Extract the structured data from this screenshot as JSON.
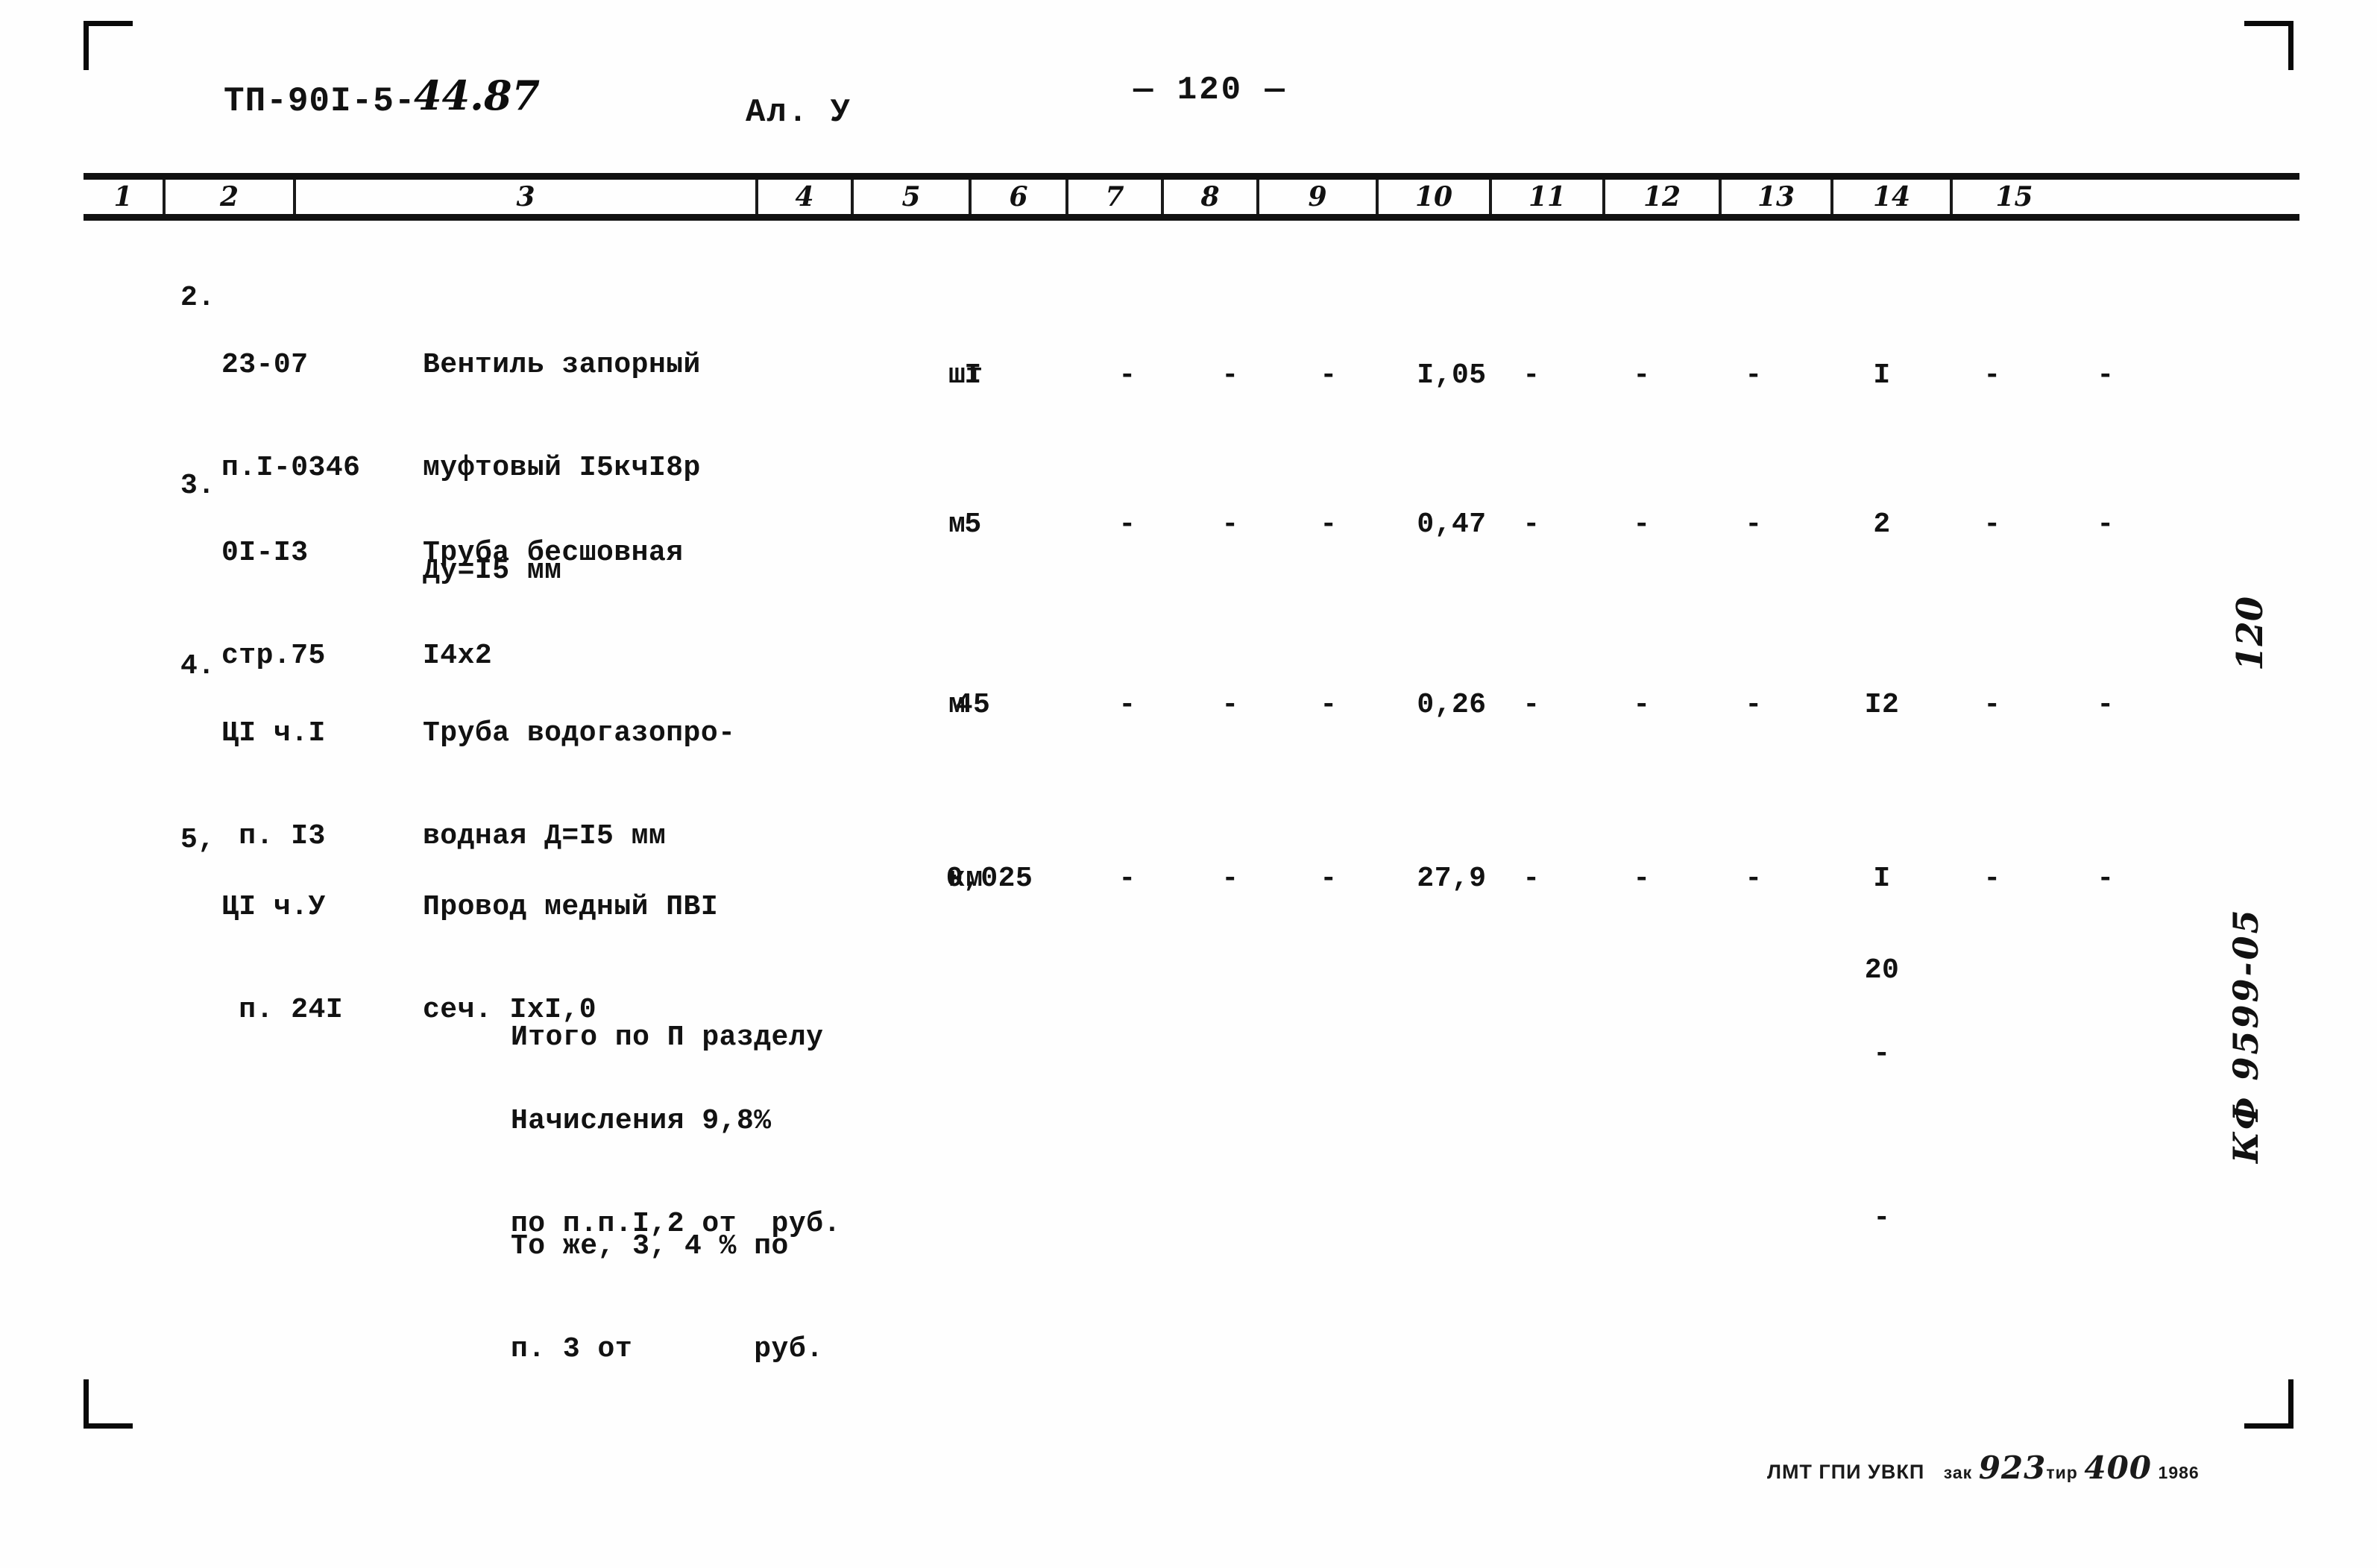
{
  "document": {
    "code_typed": "ТП-90I-5-",
    "code_handwritten": "44.87",
    "album": "Ал. У",
    "page_marker": "— 120 —"
  },
  "table": {
    "column_headers": [
      "1",
      "2",
      "3",
      "4",
      "5",
      "6",
      "7",
      "8",
      "9",
      "10",
      "11",
      "12",
      "13",
      "14",
      "15"
    ],
    "rows": [
      {
        "num": "2.",
        "code_lines": [
          "23-07",
          "п.I-0346",
          ""
        ],
        "name_lines": [
          "Вентиль запорный",
          "муфтовый I5кчI8p",
          "Ду=I5 мм"
        ],
        "unit": "шт",
        "values": {
          "c5": "I",
          "c6": "-",
          "c7": "-",
          "c8": "-",
          "c9": "I,05",
          "c10": "-",
          "c11": "-",
          "c12": "-",
          "c13": "I",
          "c14": "-",
          "c15": "-"
        }
      },
      {
        "num": "3.",
        "code_lines": [
          "0I-I3",
          "стр.75",
          ""
        ],
        "name_lines": [
          "Труба бесшовная",
          "I4x2",
          ""
        ],
        "unit": "м",
        "values": {
          "c5": "5",
          "c6": "-",
          "c7": "-",
          "c8": "-",
          "c9": "0,47",
          "c10": "-",
          "c11": "-",
          "c12": "-",
          "c13": "2",
          "c14": "-",
          "c15": "-"
        }
      },
      {
        "num": "4.",
        "code_lines": [
          "ЦI ч.I",
          " п. I3",
          ""
        ],
        "name_lines": [
          "Труба водогазопро-",
          "водная Д=I5 мм",
          ""
        ],
        "unit": "м",
        "values": {
          "c5": "45",
          "c6": "-",
          "c7": "-",
          "c8": "-",
          "c9": "0,26",
          "c10": "-",
          "c11": "-",
          "c12": "-",
          "c13": "I2",
          "c14": "-",
          "c15": "-"
        }
      },
      {
        "num": "5,",
        "code_lines": [
          "ЦI ч.У",
          " п. 24I",
          ""
        ],
        "name_lines": [
          "Провод медный ПВI",
          "сеч. IxI,0",
          ""
        ],
        "unit": "км",
        "values": {
          "c5": "0,025",
          "c6": "-",
          "c7": "-",
          "c8": "-",
          "c9": "27,9",
          "c10": "-",
          "c11": "-",
          "c12": "-",
          "c13": "I",
          "c14": "-",
          "c15": "-"
        }
      }
    ],
    "summaries": [
      {
        "label_lines": [
          "Итого по П разделу",
          ""
        ],
        "c13": "20"
      },
      {
        "label_lines": [
          "Начисления 9,8%",
          "по п.п.I,2 от  руб."
        ],
        "c13": "-"
      },
      {
        "label_lines": [
          "То же, 3, 4 % по",
          "п. 3 от       руб."
        ],
        "c13": "-"
      }
    ]
  },
  "margin_notes": {
    "page_number": "120",
    "archive_code": "КФ 9599-05"
  },
  "footer": {
    "printer": "ЛМТ ГПИ УВКП",
    "order_label": "зак",
    "order_number": "923",
    "run_label": "тир",
    "run_number": "400",
    "year": "1986"
  }
}
